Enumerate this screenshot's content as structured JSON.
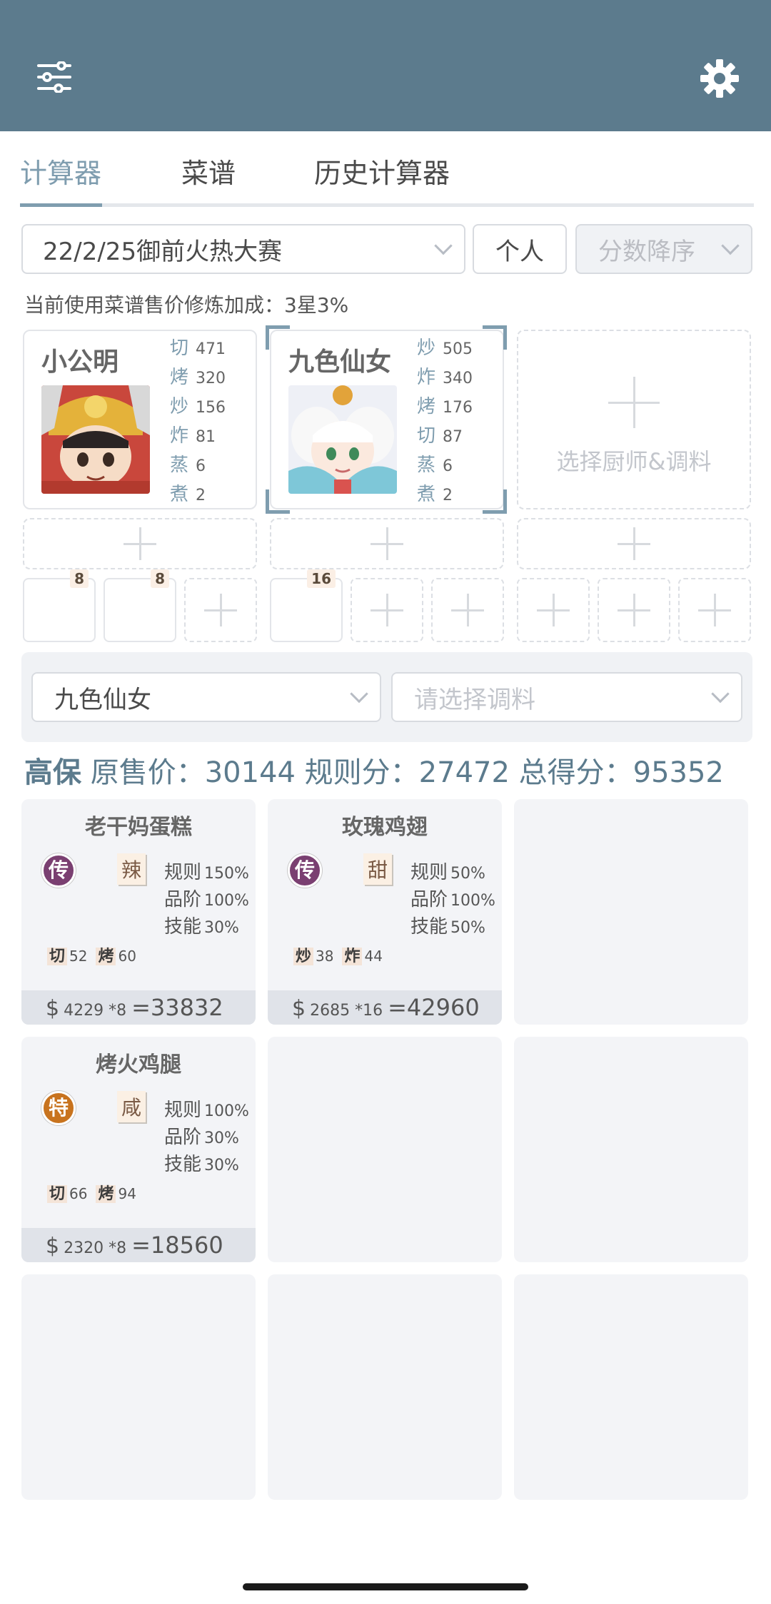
{
  "tabs": [
    {
      "label": "计算器"
    },
    {
      "label": "菜谱"
    },
    {
      "label": "历史计算器"
    }
  ],
  "filters": {
    "event": "22/2/25御前火热大赛",
    "mode": "个人",
    "sort": "分数降序"
  },
  "info_line": "当前使用菜谱售价修炼加成：3星3%",
  "chefs": [
    {
      "name": "小公明",
      "skills": [
        {
          "k": "切",
          "v": "471"
        },
        {
          "k": "烤",
          "v": "320"
        },
        {
          "k": "炒",
          "v": "156"
        },
        {
          "k": "炸",
          "v": "81"
        },
        {
          "k": "蒸",
          "v": "6"
        },
        {
          "k": "煮",
          "v": "2"
        }
      ],
      "badges": [
        "8",
        "8"
      ]
    },
    {
      "name": "九色仙女",
      "skills": [
        {
          "k": "炒",
          "v": "505"
        },
        {
          "k": "炸",
          "v": "340"
        },
        {
          "k": "烤",
          "v": "176"
        },
        {
          "k": "切",
          "v": "87"
        },
        {
          "k": "蒸",
          "v": "6"
        },
        {
          "k": "煮",
          "v": "2"
        }
      ],
      "badges": [
        "16"
      ]
    }
  ],
  "add_chef_label": "选择厨师&调料",
  "selector": {
    "chef": "九色仙女",
    "seasoning_placeholder": "请选择调料"
  },
  "summary": {
    "tag": "高保",
    "text": "原售价：30144 规则分：27472 总得分：95352"
  },
  "recipes": [
    {
      "name": "老干妈蛋糕",
      "rarity": "传",
      "taste": "辣",
      "rule_label": "规则",
      "rule": "150%",
      "grade_label": "品阶",
      "grade": "100%",
      "skill_label": "技能",
      "skill": "30%",
      "req": [
        {
          "k": "切",
          "v": "52"
        },
        {
          "k": "烤",
          "v": "60"
        }
      ],
      "price": "4229",
      "qty": "*8",
      "total": "=33832"
    },
    {
      "name": "玫瑰鸡翅",
      "rarity": "传",
      "taste": "甜",
      "rule_label": "规则",
      "rule": "50%",
      "grade_label": "品阶",
      "grade": "100%",
      "skill_label": "技能",
      "skill": "50%",
      "req": [
        {
          "k": "炒",
          "v": "38"
        },
        {
          "k": "炸",
          "v": "44"
        }
      ],
      "price": "2685",
      "qty": "*16",
      "total": "=42960"
    },
    {
      "name": "烤火鸡腿",
      "rarity": "特",
      "taste": "咸",
      "rule_label": "规则",
      "rule": "100%",
      "grade_label": "品阶",
      "grade": "30%",
      "skill_label": "技能",
      "skill": "30%",
      "req": [
        {
          "k": "切",
          "v": "66"
        },
        {
          "k": "烤",
          "v": "94"
        }
      ],
      "price": "2320",
      "qty": "*8",
      "total": "=18560"
    }
  ],
  "currency_symbol": "$",
  "icons": {
    "menu": "sliders-icon",
    "settings": "gear-icon"
  },
  "colors": {
    "header": "#5c7b8d",
    "accent": "#7f9daf"
  }
}
